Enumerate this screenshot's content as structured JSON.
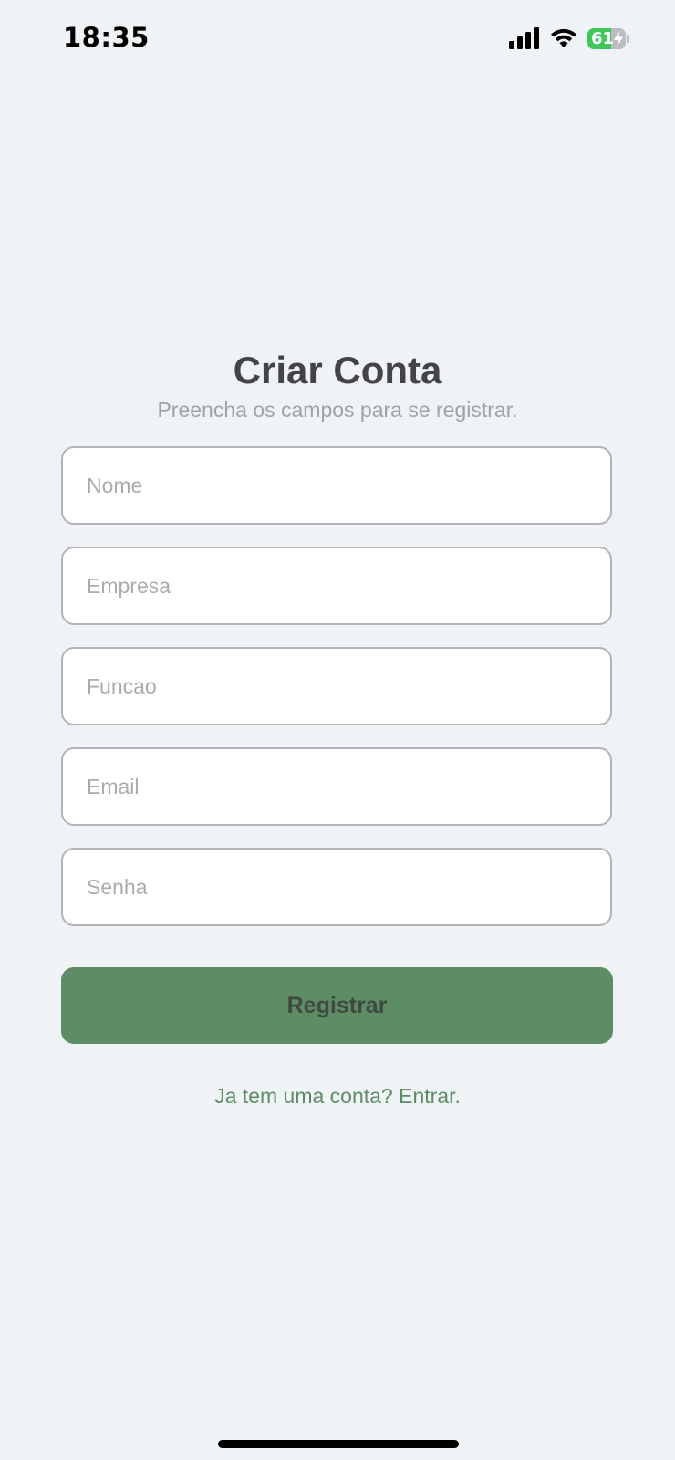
{
  "status_bar": {
    "time": "18:35",
    "battery_level": "61",
    "battery_charging": true,
    "battery_color": "#3fc75a",
    "icons": [
      "cellular-signal-icon",
      "wifi-icon",
      "battery-charging-icon"
    ]
  },
  "form": {
    "title": "Criar Conta",
    "subtitle": "Preencha os campos para se registrar.",
    "fields": [
      {
        "placeholder": "Nome",
        "value": ""
      },
      {
        "placeholder": "Empresa",
        "value": ""
      },
      {
        "placeholder": "Funcao",
        "value": ""
      },
      {
        "placeholder": "Email",
        "value": ""
      },
      {
        "placeholder": "Senha",
        "value": ""
      }
    ],
    "submit_label": "Registrar",
    "login_link": "Ja tem uma conta? Entrar."
  },
  "colors": {
    "background": "#eff3f6",
    "accent": "#5d8c65",
    "title": "#444446",
    "muted": "#a0a2a5"
  }
}
